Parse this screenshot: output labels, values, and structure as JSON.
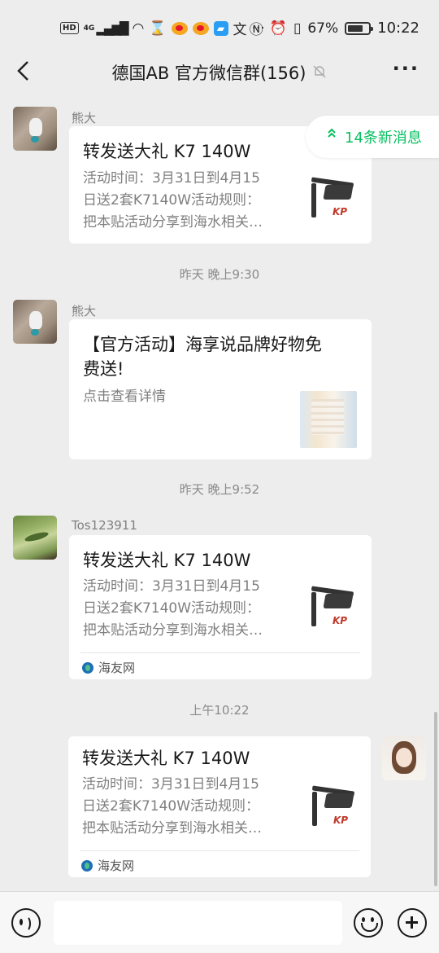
{
  "status_bar": {
    "left_chips": [
      "HD",
      "4G"
    ],
    "battery": "67%",
    "time": "10:22"
  },
  "header": {
    "title": "德国AB  官方微信群(156)"
  },
  "new_messages_label": "14条新消息",
  "messages": [
    {
      "type": "link_card",
      "sender": "熊大",
      "avatar": "bear-avatar",
      "title": "转发送大礼 K7 140W",
      "desc": "活动时间：3月31日到4月15日送2套K7140W活动规则：把本贴活动分享到海水相关…",
      "desc_lines": [
        "活动时间：3月31日到4月15",
        "日送2套K7140W活动规则：",
        "把本贴活动分享到海水相关…"
      ],
      "thumb": "aquarium-lamp",
      "thumb_logo": "KP"
    },
    {
      "type": "time",
      "text": "昨天 晚上9:30"
    },
    {
      "type": "link_card",
      "sender": "熊大",
      "avatar": "bear-avatar",
      "title_lines": [
        "【官方活动】海享说品牌好物免",
        "费送!"
      ],
      "desc_lines": [
        "点击查看详情"
      ],
      "thumb": "document-thumbnail"
    },
    {
      "type": "time",
      "text": "昨天 晚上9:52"
    },
    {
      "type": "link_card",
      "sender": "Tos123911",
      "avatar": "frog-avatar",
      "title": "转发送大礼 K7 140W",
      "desc_lines": [
        "活动时间：3月31日到4月15",
        "日送2套K7140W活动规则：",
        "把本贴活动分享到海水相关…"
      ],
      "thumb": "aquarium-lamp",
      "thumb_logo": "KP",
      "source": "海友网"
    },
    {
      "type": "time",
      "text": "上午10:22"
    },
    {
      "type": "link_card",
      "sender": "",
      "avatar": "girl-avatar",
      "title": "转发送大礼 K7 140W",
      "desc_lines": [
        "活动时间：3月31日到4月15",
        "日送2套K7140W活动规则：",
        "把本贴活动分享到海水相关…"
      ],
      "thumb": "aquarium-lamp",
      "thumb_logo": "KP",
      "source": "海友网"
    }
  ],
  "colors": {
    "background": "#ededed",
    "accent_green": "#07c160",
    "card": "#ffffff",
    "secondary_text": "#7f7f7f"
  },
  "icons": [
    "back-icon",
    "mute-bell-icon",
    "more-icon",
    "voice-icon",
    "emoji-icon",
    "plus-icon",
    "double-chevron-up-icon"
  ]
}
